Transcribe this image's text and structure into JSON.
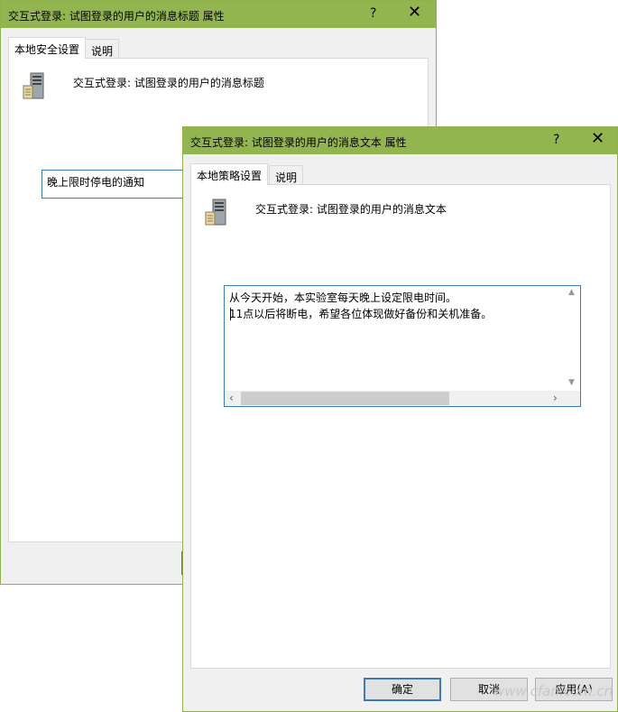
{
  "back_window": {
    "title": "交互式登录: 试图登录的用户的消息标题 属性",
    "help_label": "?",
    "close_label": "✕",
    "tabs": [
      {
        "label": "本地安全设置"
      },
      {
        "label": "说明"
      }
    ],
    "policy_name": "交互式登录: 试图登录的用户的消息标题",
    "field_value": "晚上限时停电的通知"
  },
  "front_window": {
    "title": "交互式登录: 试图登录的用户的消息文本 属性",
    "help_label": "?",
    "close_label": "✕",
    "tabs": [
      {
        "label": "本地策略设置"
      },
      {
        "label": "说明"
      }
    ],
    "policy_name": "交互式登录: 试图登录的用户的消息文本",
    "message_lines": [
      "从今天开始，本实验室每天晚上设定限电时间。",
      "11点以后将断电，希望各位体现做好备份和关机准备。"
    ],
    "buttons": {
      "ok": "确定",
      "cancel": "取消",
      "apply": "应用(A)"
    }
  },
  "watermark": "www.cfan.com.cn",
  "colors": {
    "titlebar": "#93b550",
    "focus_border": "#3d7ab8"
  }
}
